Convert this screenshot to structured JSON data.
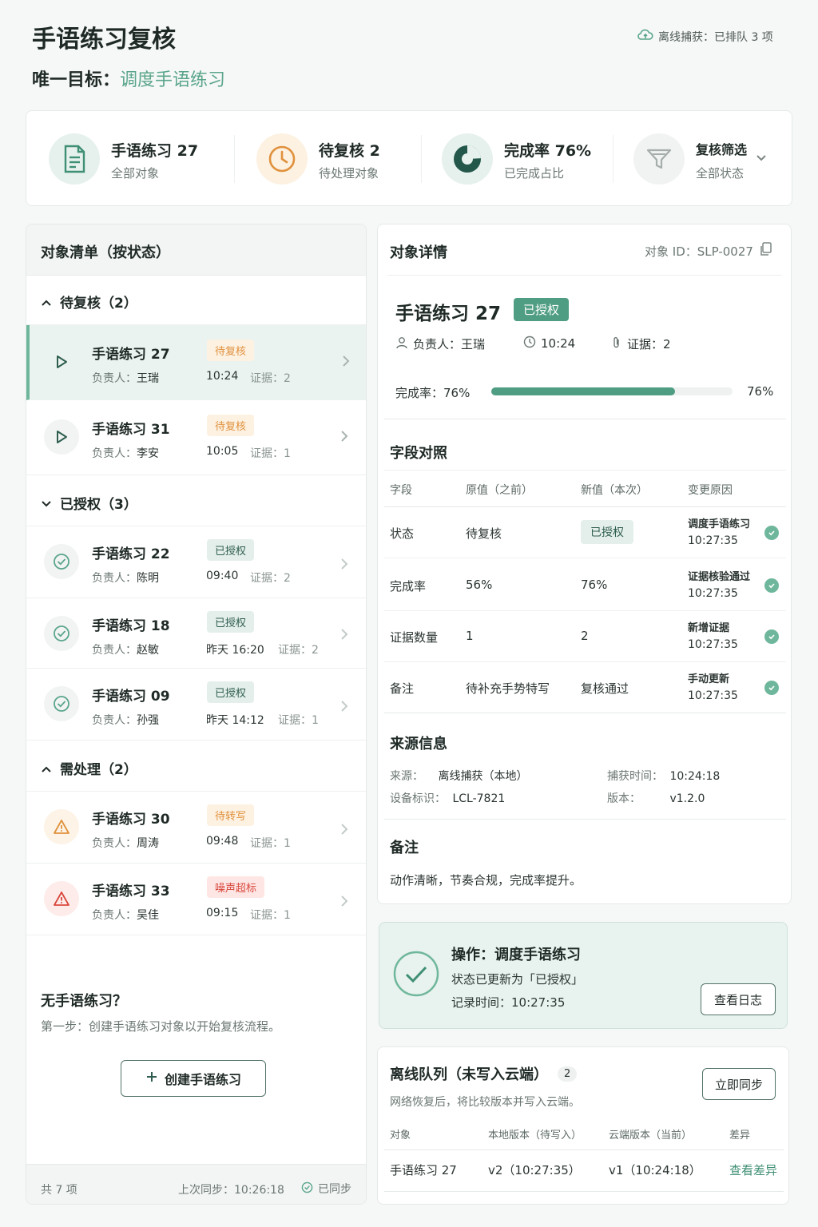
{
  "header": {
    "title": "手语练习复核",
    "goal_label": "唯一目标：",
    "goal_value": "调度手语练习",
    "offline_status": "离线捕获：已排队 3 项"
  },
  "stats": [
    {
      "title": "手语练习 27",
      "sub": "全部对象",
      "icon": "document-icon"
    },
    {
      "title": "待复核 2",
      "sub": "待处理对象",
      "icon": "clock-icon"
    },
    {
      "title": "完成率 76%",
      "sub": "已完成占比",
      "icon": "pie-icon",
      "value_percent": 76
    },
    {
      "title": "复核筛选",
      "sub": "全部状态",
      "icon": "filter-icon"
    }
  ],
  "list": {
    "header": "对象清单（按状态）",
    "groups": [
      {
        "label": "待复核（2）"
      },
      {
        "label": "已授权（3）"
      },
      {
        "label": "需处理（2）"
      }
    ],
    "items": [
      {
        "title": "手语练习 27",
        "badge": "待复核",
        "owner_label": "负责人：",
        "owner": "王瑞",
        "time": "10:24",
        "evidence": "证据：2"
      },
      {
        "title": "手语练习 31",
        "badge": "待复核",
        "owner_label": "负责人：",
        "owner": "李安",
        "time": "10:05",
        "evidence": "证据：1"
      },
      {
        "title": "手语练习 22",
        "badge": "已授权",
        "owner_label": "负责人：",
        "owner": "陈明",
        "time": "09:40",
        "evidence": "证据：2"
      },
      {
        "title": "手语练习 18",
        "badge": "已授权",
        "owner_label": "负责人：",
        "owner": "赵敏",
        "time": "昨天 16:20",
        "evidence": "证据：2"
      },
      {
        "title": "手语练习 09",
        "badge": "已授权",
        "owner_label": "负责人：",
        "owner": "孙强",
        "time": "昨天 14:12",
        "evidence": "证据：1"
      },
      {
        "title": "手语练习 30",
        "badge": "待转写",
        "owner_label": "负责人：",
        "owner": "周涛",
        "time": "09:48",
        "evidence": "证据：1"
      },
      {
        "title": "手语练习 33",
        "badge": "噪声超标",
        "owner_label": "负责人：",
        "owner": "吴佳",
        "time": "09:15",
        "evidence": "证据：1"
      }
    ],
    "empty_title": "无手语练习？",
    "empty_desc": "第一步：创建手语练习对象以开始复核流程。",
    "create_button": "创建手语练习",
    "footer_count": "共 7 项",
    "footer_sync": "上次同步：10:26:18",
    "footer_synced": "已同步"
  },
  "detail": {
    "header": "对象详情",
    "object_id": "对象 ID：SLP-0027",
    "title": "手语练习 27",
    "badge": "已授权",
    "owner": "负责人：王瑞",
    "time": "10:24",
    "evidence": "证据：2",
    "progress_label": "完成率：76%",
    "progress_value": "76%",
    "progress_percent": 76
  },
  "fields": {
    "header": "字段对照",
    "columns": [
      "字段",
      "原值（之前）",
      "新值（本次）",
      "变更原因"
    ],
    "rows": [
      {
        "field": "状态",
        "old": "待复核",
        "new": "已授权",
        "reason": "调度手语练习",
        "time": "10:27:35"
      },
      {
        "field": "完成率",
        "old": "56%",
        "new": "76%",
        "reason": "证据核验通过",
        "time": "10:27:35"
      },
      {
        "field": "证据数量",
        "old": "1",
        "new": "2",
        "reason": "新增证据",
        "time": "10:27:35"
      },
      {
        "field": "备注",
        "old": "待补充手势特写",
        "new": "复核通过",
        "reason": "手动更新",
        "time": "10:27:35"
      }
    ]
  },
  "source": {
    "header": "来源信息",
    "source_label": "来源：",
    "source_value": "离线捕获（本地）",
    "device_label": "设备标识：",
    "device_value": "LCL-7821",
    "capture_label": "捕获时间：",
    "capture_value": "10:24:18",
    "version_label": "版本：",
    "version_value": "v1.2.0"
  },
  "notes": {
    "header": "备注",
    "text": "动作清晰，节奏合规，完成率提升。"
  },
  "action": {
    "title": "操作：调度手语练习",
    "status": "状态已更新为「已授权」",
    "time": "记录时间：10:27:35",
    "button": "查看日志"
  },
  "queue": {
    "header": "离线队列（未写入云端）",
    "count": "2",
    "desc": "网络恢复后，将比较版本并写入云端。",
    "button": "立即同步",
    "columns": [
      "对象",
      "本地版本（待写入）",
      "云端版本（当前）",
      "差异"
    ],
    "row": {
      "object": "手语练习 27",
      "local": "v2（10:27:35）",
      "cloud": "v1（10:24:18）",
      "diff": "查看差异"
    }
  },
  "colors": {
    "accent": "#3f8f75",
    "pending": "#e0913c",
    "danger": "#d9473c"
  }
}
